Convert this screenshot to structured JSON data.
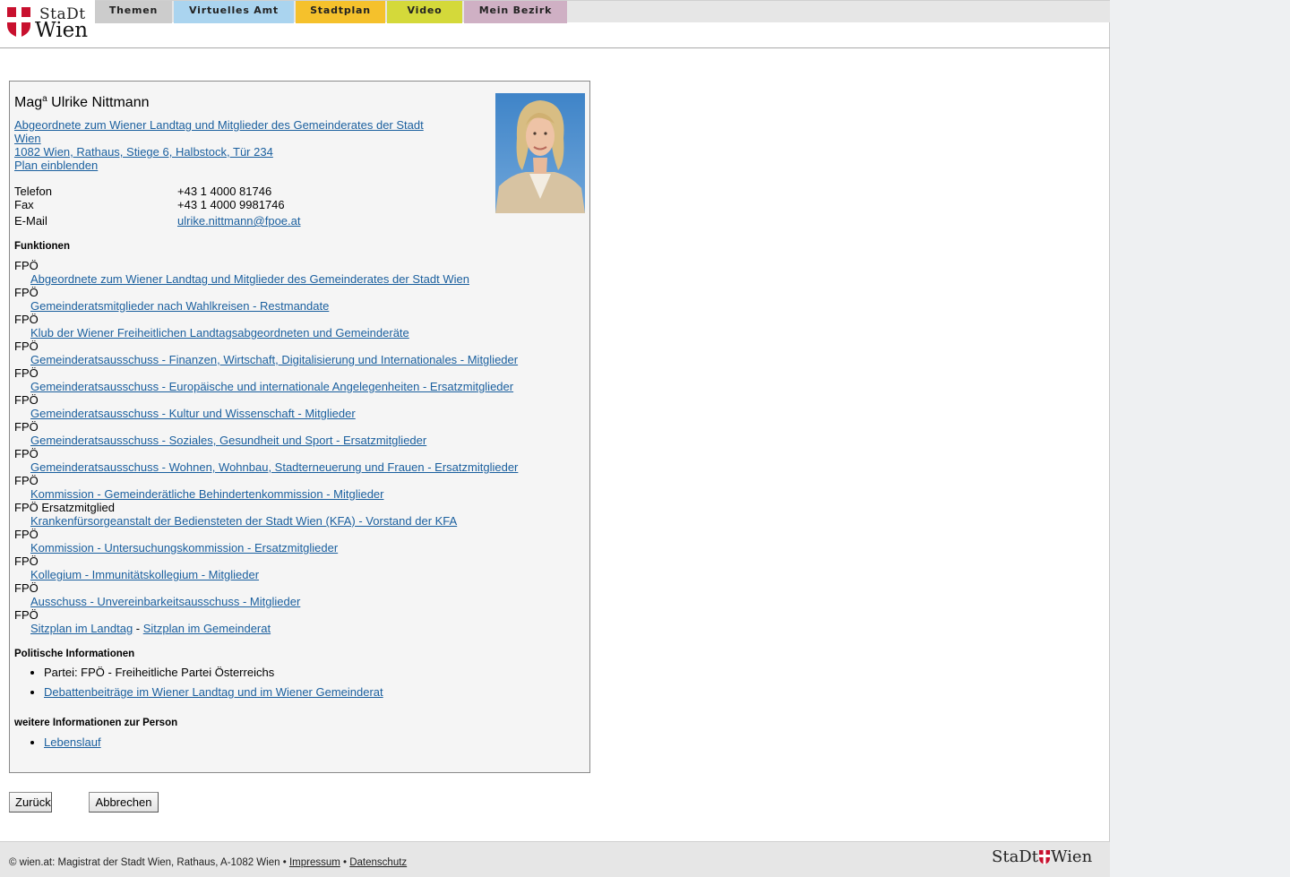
{
  "logo": {
    "top": "StaDt",
    "bottom": "Wien"
  },
  "nav": {
    "tabs": [
      {
        "label": "Themen",
        "color": "#cccccc"
      },
      {
        "label": "Virtuelles Amt",
        "color": "#aad4ef"
      },
      {
        "label": "Stadtplan",
        "color": "#f5c12c"
      },
      {
        "label": "Video",
        "color": "#d4d93a"
      },
      {
        "label": "Mein Bezirk",
        "color": "#cfb0c4"
      }
    ]
  },
  "person": {
    "title_prefix": "Mag",
    "title_sup": "a",
    "name": " Ulrike Nittmann",
    "position_line1": "Abgeordnete zum Wiener Landtag und Mitglieder des Gemeinderates der Stadt",
    "position_line2": "Wien ",
    "address": "1082 Wien, Rathaus, Stiege 6, Halbstock, Tür 234",
    "plan_link": "Plan einblenden"
  },
  "contact": {
    "phone_label": "Telefon",
    "phone": "+43 1 4000 81746",
    "fax_label": "Fax",
    "fax": "+43 1 4000 9981746",
    "email_label": "E-Mail",
    "email": "ulrike.nittmann@fpoe.at"
  },
  "functions": {
    "heading": "Funktionen",
    "items": [
      {
        "party": "FPÖ",
        "link": "Abgeordnete zum Wiener Landtag und Mitglieder des Gemeinderates der Stadt Wien"
      },
      {
        "party": "FPÖ",
        "link": "Gemeinderatsmitglieder nach Wahlkreisen - Restmandate"
      },
      {
        "party": "FPÖ",
        "link": "Klub der Wiener Freiheitlichen Landtagsabgeordneten und Gemeinderäte"
      },
      {
        "party": "FPÖ",
        "link": "Gemeinderatsausschuss - Finanzen, Wirtschaft, Digitalisierung und Internationales - Mitglieder"
      },
      {
        "party": "FPÖ",
        "link": "Gemeinderatsausschuss - Europäische und internationale Angelegenheiten - Ersatzmitglieder"
      },
      {
        "party": "FPÖ",
        "link": "Gemeinderatsausschuss - Kultur und Wissenschaft - Mitglieder"
      },
      {
        "party": "FPÖ",
        "link": "Gemeinderatsausschuss - Soziales, Gesundheit und Sport - Ersatzmitglieder"
      },
      {
        "party": "FPÖ",
        "link": "Gemeinderatsausschuss - Wohnen, Wohnbau, Stadterneuerung und Frauen - Ersatzmitglieder"
      },
      {
        "party": "FPÖ",
        "link": "Kommission - Gemeinderätliche Behindertenkommission - Mitglieder"
      },
      {
        "party": "FPÖ Ersatzmitglied",
        "link": "Krankenfürsorgeanstalt der Bediensteten der Stadt Wien (KFA) - Vorstand der KFA"
      },
      {
        "party": "FPÖ",
        "link": "Kommission - Untersuchungskommission - Ersatzmitglieder"
      },
      {
        "party": "FPÖ",
        "link": "Kollegium - Immunitätskollegium - Mitglieder"
      },
      {
        "party": "FPÖ",
        "link": "Ausschuss - Unvereinbarkeitsausschuss - Mitglieder"
      }
    ],
    "last_party": "FPÖ",
    "seat_landtag": "Sitzplan im Landtag",
    "seat_sep": " - ",
    "seat_gemeinderat": "Sitzplan im Gemeinderat"
  },
  "political": {
    "heading": "Politische Informationen",
    "party": "Partei: FPÖ - Freiheitliche Partei Österreichs",
    "debates": "Debattenbeiträge im Wiener Landtag und im Wiener Gemeinderat"
  },
  "more": {
    "heading": "weitere Informationen zur Person",
    "cv": "Lebenslauf"
  },
  "buttons": {
    "back": "Zurück",
    "cancel": "Abbrechen"
  },
  "footer": {
    "copyright": "© wien.at: Magistrat der Stadt Wien, Rathaus, A-1082 Wien",
    "bullet": " • ",
    "impressum": "Impressum",
    "datenschutz": "Datenschutz",
    "logo_left": "StaDt",
    "logo_right": "Wien"
  }
}
